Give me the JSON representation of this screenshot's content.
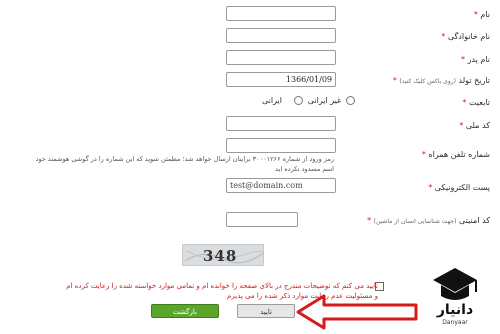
{
  "fields": {
    "first_name": {
      "label": "نام",
      "star": "*"
    },
    "last_name": {
      "label": "نام خانوادگی",
      "star": "*"
    },
    "father_name": {
      "label": "نام پدر",
      "star": "*"
    },
    "birth_date": {
      "label": "تاریخ تولد",
      "hint": "(روی باکس کلیک کنید)",
      "star": "*",
      "value": "1366/01/09"
    },
    "nationality": {
      "label": "تابعیت",
      "star": "*",
      "options": [
        "ایرانی",
        "غیر ایرانی"
      ]
    },
    "national_code": {
      "label": "کد ملی",
      "star": "*"
    },
    "phone": {
      "label": "شماره تلفن همراه",
      "star": "*",
      "note_line1": "رمز ورود از شماره ۳۰۰۰۱۲۶۶ برایتان ارسال خواهد شد؛ مطمئن شوید که این شماره را در گوشی هوشمند خود",
      "note_line2": "اسم مسدود نکرده اید"
    },
    "email": {
      "label": "پست الکترونیکی",
      "star": "*",
      "placeholder": "test@domain.com"
    },
    "security_code": {
      "label": "کد امنیتی",
      "star": "*",
      "hint": "(جهت شناسایی انسان از ماشین)"
    }
  },
  "captcha": {
    "text": "348"
  },
  "terms": {
    "line1": "تایید می کنم که توضیحات مندرج در بالای صفحه را خوانده ام و تمامی موارد خواسته شده را رعایت کرده ام",
    "line2": "و مسئولیت عدم رعایت موارد ذکر شده را می پذیرم"
  },
  "buttons": {
    "back": "بازگشت",
    "confirm": "تایید"
  },
  "watermark": {
    "brand": "دانیار",
    "latin": "Danyaar"
  }
}
